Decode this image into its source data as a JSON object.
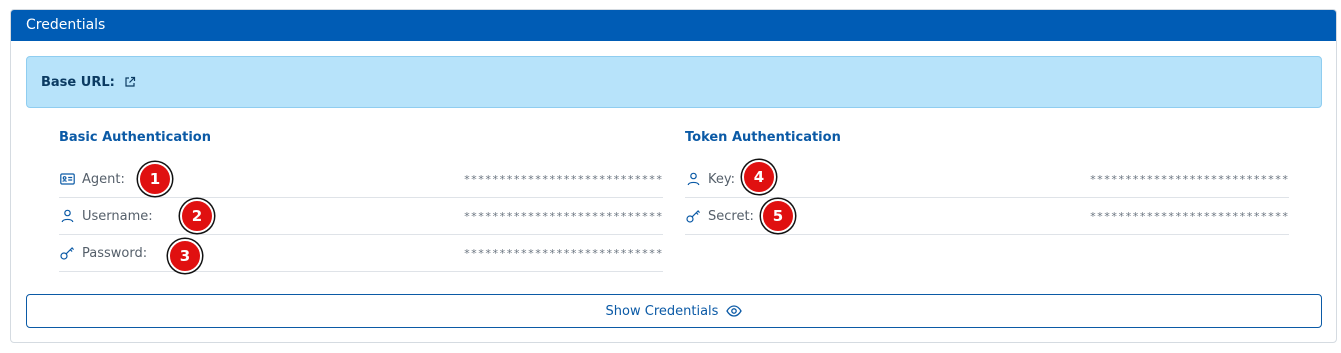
{
  "card": {
    "title": "Credentials"
  },
  "base_url": {
    "label": "Base URL:",
    "icon": "external-link-icon"
  },
  "basic_auth": {
    "title": "Basic Authentication",
    "rows": [
      {
        "label": "Agent:",
        "value": "****************************",
        "icon": "id-card-icon",
        "badge": "1"
      },
      {
        "label": "Username:",
        "value": "****************************",
        "icon": "user-icon",
        "badge": "2"
      },
      {
        "label": "Password:",
        "value": "****************************",
        "icon": "key-icon",
        "badge": "3"
      }
    ]
  },
  "token_auth": {
    "title": "Token Authentication",
    "rows": [
      {
        "label": "Key:",
        "value": "****************************",
        "icon": "user-icon",
        "badge": "4"
      },
      {
        "label": "Secret:",
        "value": "****************************",
        "icon": "key-icon",
        "badge": "5"
      }
    ]
  },
  "show_button": {
    "label": "Show Credentials",
    "icon": "eye-icon"
  },
  "colors": {
    "header": "#005cb5",
    "accent": "#0b5aa6",
    "info_bg": "#b7e3fa",
    "badge": "#e01010"
  }
}
